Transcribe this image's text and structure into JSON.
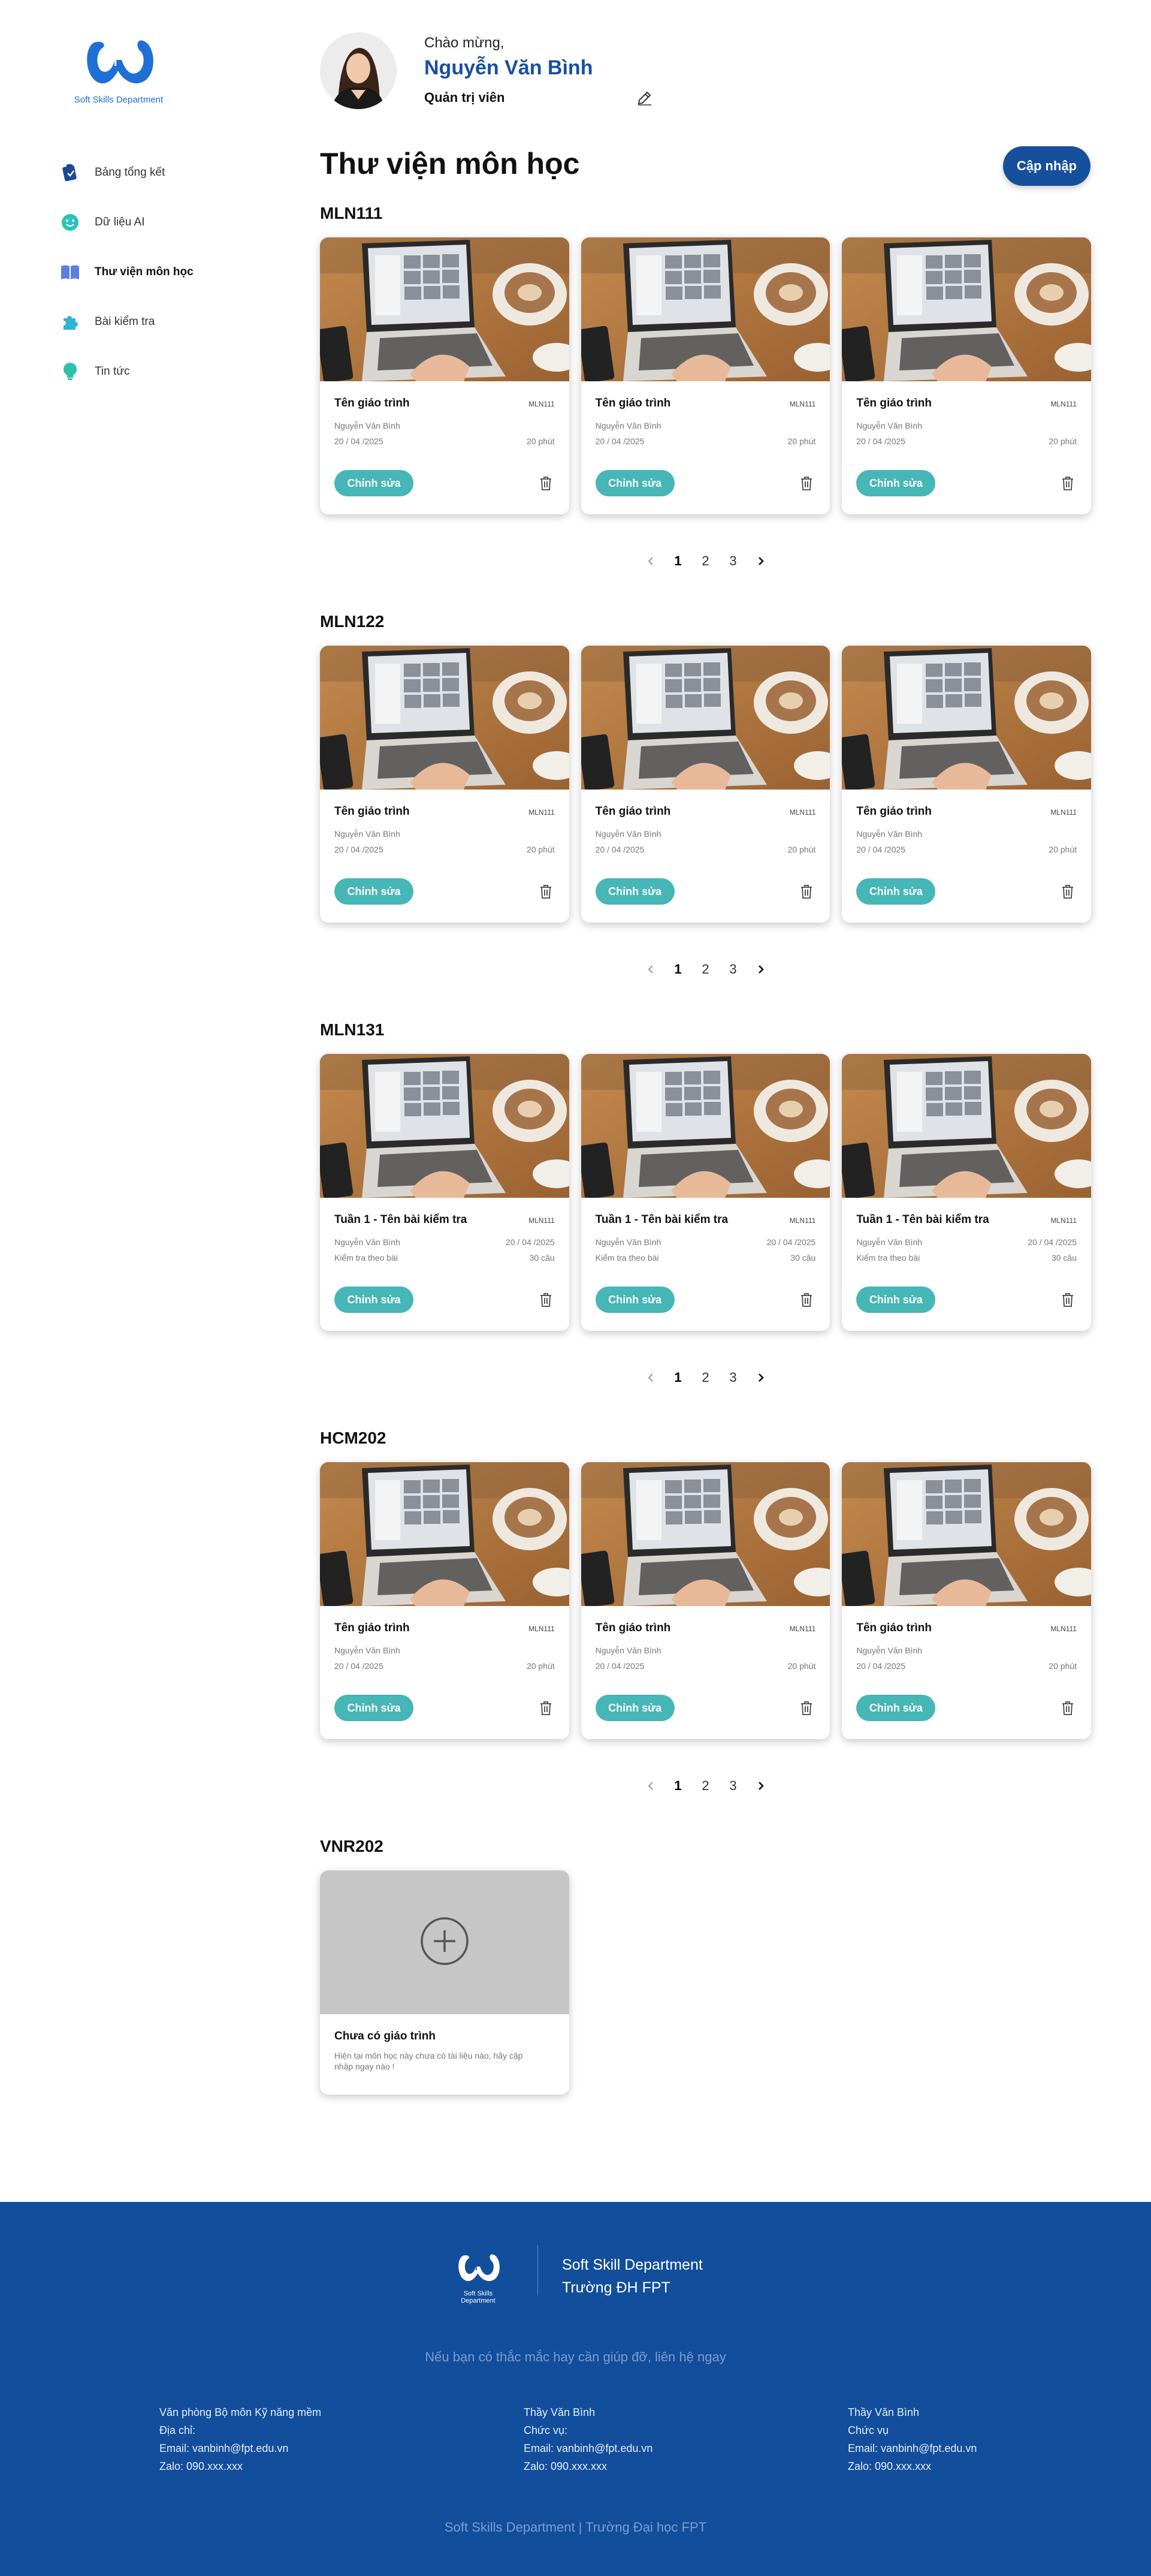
{
  "sidebar": {
    "logo_caption": "Soft Skills Department",
    "items": [
      {
        "label": "Bảng tổng kết",
        "icon": "clipboard-icon"
      },
      {
        "label": "Dữ liệu AI",
        "icon": "smile-icon"
      },
      {
        "label": "Thư viện môn học",
        "icon": "book-icon",
        "active": true
      },
      {
        "label": "Bài kiểm tra",
        "icon": "puzzle-icon"
      },
      {
        "label": "Tin tức",
        "icon": "lightbulb-icon"
      }
    ]
  },
  "header": {
    "greeting": "Chào mừng,",
    "name": "Nguyễn Văn Bình",
    "role": "Quản trị viên"
  },
  "main": {
    "title": "Thư viện môn học",
    "update_label": "Cập nhập"
  },
  "colors": {
    "brand_blue": "#164f9c",
    "accent_teal": "#46b6b6",
    "footer_bg": "#124e9c"
  },
  "sections": [
    {
      "title": "MLN111",
      "cards": [
        {
          "title": "Tên giáo trình",
          "code": "MLN111",
          "author": "Nguyễn Văn Bình",
          "date": "20 / 04 /2025",
          "extra": "20 phút"
        },
        {
          "title": "Tên giáo trình",
          "code": "MLN111",
          "author": "Nguyễn Văn Bình",
          "date": "20 / 04 /2025",
          "extra": "20 phút"
        },
        {
          "title": "Tên giáo trình",
          "code": "MLN111",
          "author": "Nguyễn Văn Bình",
          "date": "20 / 04 /2025",
          "extra": "20 phút"
        }
      ],
      "pages": [
        "1",
        "2",
        "3"
      ]
    },
    {
      "title": "MLN122",
      "cards": [
        {
          "title": "Tên giáo trình",
          "code": "MLN111",
          "author": "Nguyễn Văn Bình",
          "date": "20 / 04 /2025",
          "extra": "20 phút"
        },
        {
          "title": "Tên giáo trình",
          "code": "MLN111",
          "author": "Nguyễn Văn Bình",
          "date": "20 / 04 /2025",
          "extra": "20 phút"
        },
        {
          "title": "Tên giáo trình",
          "code": "MLN111",
          "author": "Nguyễn Văn Bình",
          "date": "20 / 04 /2025",
          "extra": "20 phút"
        }
      ],
      "pages": [
        "1",
        "2",
        "3"
      ]
    },
    {
      "title": "MLN131",
      "cards": [
        {
          "title": "Tuần 1 - Tên bài kiểm tra",
          "code": "MLN111",
          "author": "Nguyễn Văn Bình",
          "date": "20 / 04 /2025",
          "type": "Kiểm tra theo bài",
          "extra": "30 câu"
        },
        {
          "title": "Tuần 1 - Tên bài kiểm tra",
          "code": "MLN111",
          "author": "Nguyễn Văn Bình",
          "date": "20 / 04 /2025",
          "type": "Kiểm tra theo bài",
          "extra": "30 câu"
        },
        {
          "title": "Tuần 1 - Tên bài kiểm tra",
          "code": "MLN111",
          "author": "Nguyễn Văn Bình",
          "date": "20 / 04 /2025",
          "type": "Kiểm tra theo bài",
          "extra": "30 câu"
        }
      ],
      "pages": [
        "1",
        "2",
        "3"
      ]
    },
    {
      "title": "HCM202",
      "cards": [
        {
          "title": "Tên giáo trình",
          "code": "MLN111",
          "author": "Nguyễn Văn Bình",
          "date": "20 / 04 /2025",
          "extra": "20 phút"
        },
        {
          "title": "Tên giáo trình",
          "code": "MLN111",
          "author": "Nguyễn Văn Bình",
          "date": "20 / 04 /2025",
          "extra": "20 phút"
        },
        {
          "title": "Tên giáo trình",
          "code": "MLN111",
          "author": "Nguyễn Văn Bình",
          "date": "20 / 04 /2025",
          "extra": "20 phút"
        }
      ],
      "pages": [
        "1",
        "2",
        "3"
      ]
    }
  ],
  "card_actions": {
    "edit_label": "Chỉnh sửa"
  },
  "empty_section": {
    "title": "VNR202",
    "card_title": "Chưa có giáo trình",
    "card_desc": "Hiện tại môn học này chưa có tài liệu nào, hãy cập nhập ngay nào !"
  },
  "footer": {
    "logo_caption": "Soft Skills Department",
    "dept_line1": "Soft Skill Department",
    "dept_line2": "Trường ĐH FPT",
    "help": "Nếu bạn có thắc mắc hay cần giúp đỡ, liên hệ ngay",
    "col1": [
      "Văn phòng Bộ môn Kỹ năng mềm",
      "Địa chỉ:",
      "Email: vanbinh@fpt.edu.vn",
      "Zalo: 090.xxx.xxx"
    ],
    "col2": [
      "Thầy Văn Bình",
      "Chức vụ:",
      "Email: vanbinh@fpt.edu.vn",
      "Zalo: 090.xxx.xxx"
    ],
    "col3": [
      "Thầy Văn Bình",
      "Chức vụ",
      "Email: vanbinh@fpt.edu.vn",
      "Zalo: 090.xxx.xxx"
    ],
    "bottom": "Soft Skills Department | Trường Đại học FPT"
  }
}
